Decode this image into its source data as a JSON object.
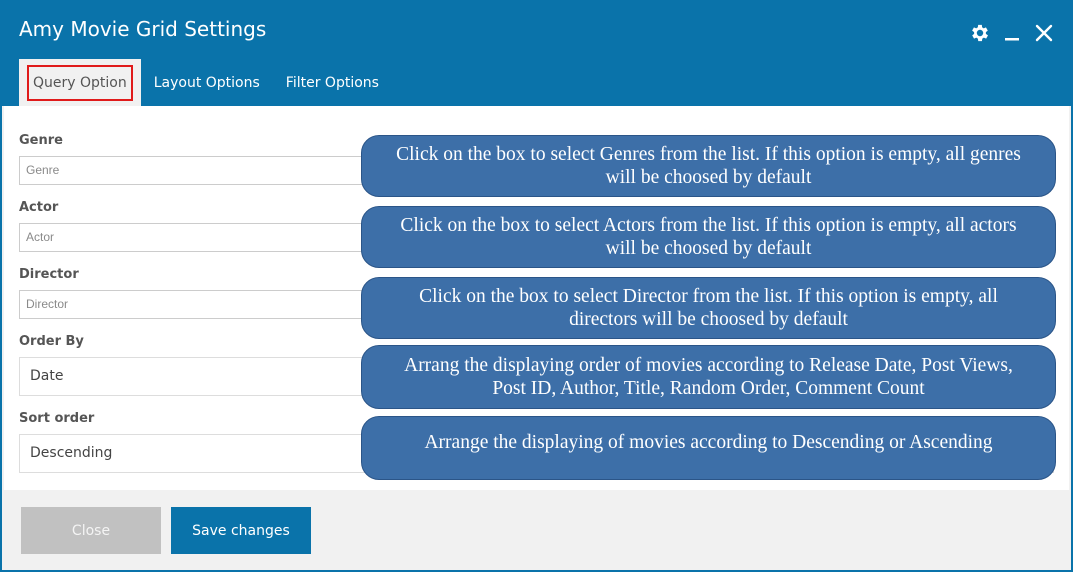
{
  "window": {
    "title": "Amy Movie Grid Settings",
    "controls": [
      "gear-icon",
      "minimize-icon",
      "close-icon"
    ]
  },
  "tabs": [
    {
      "label": "Query Option",
      "active": true
    },
    {
      "label": "Layout Options",
      "active": false
    },
    {
      "label": "Filter Options",
      "active": false
    }
  ],
  "fields": {
    "genre": {
      "label": "Genre",
      "placeholder": "Genre"
    },
    "actor": {
      "label": "Actor",
      "placeholder": "Actor"
    },
    "director": {
      "label": "Director",
      "placeholder": "Director"
    },
    "order_by": {
      "label": "Order By",
      "value": "Date"
    },
    "sort_order": {
      "label": "Sort order",
      "value": "Descending"
    }
  },
  "callouts": {
    "genre": "Click on the box to select Genres from the list. If this option is empty, all genres will be choosed by default",
    "actor": "Click on the box to select Actors from the list. If this option is empty, all actors will be choosed by default",
    "director": "Click on the box to select Director from the list. If this option is empty, all directors will be choosed by default",
    "order_by": "Arrang the displaying order of movies according to Release Date, Post Views, Post ID, Author, Title, Random Order, Comment Count",
    "sort_order": "Arrange the displaying of movies according to Descending or Ascending"
  },
  "footer": {
    "close_label": "Close",
    "save_label": "Save changes"
  },
  "colors": {
    "brand": "#0a73aa",
    "callout": "#3d6fa8",
    "highlight": "#e01b1b"
  }
}
